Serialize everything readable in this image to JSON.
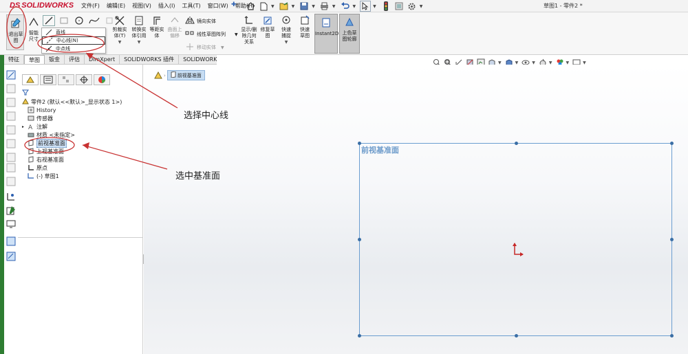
{
  "app": {
    "logo_prefix": "DS",
    "logo_name": "SOLIDWORKS",
    "document_title": "草图1 - 零件2 *"
  },
  "menu": [
    "文件(F)",
    "编辑(E)",
    "视图(V)",
    "插入(I)",
    "工具(T)",
    "窗口(W)",
    "帮助(H)"
  ],
  "ribbon": {
    "exit_sketch": "退出草图",
    "smart_dim": "智能尺寸",
    "line_flyout": [
      "直线",
      "中心线(N)",
      "中点线"
    ],
    "trim": "剪裁实体(T)",
    "convert": "转换实体引用",
    "offset": "等距实体",
    "surface_offset": "曲面上偏移",
    "mirror": "镜向实体",
    "linear_pattern": "线性草图阵列",
    "move": "移动实体",
    "display_relations": "显示/删除几何关系",
    "repair": "修复草图",
    "quick_snap": "快速捕捉",
    "rapid_sketch": "快速草图",
    "instant2d": "Instant2D",
    "shaded_contours": "上色草图轮廓"
  },
  "tabs": [
    "特征",
    "草图",
    "钣金",
    "评估",
    "DimXpert",
    "SOLIDWORKS 插件",
    "SOLIDWORKS MBD"
  ],
  "tree": {
    "root": "零件2 (默认<<默认>_显示状态 1>)",
    "items": [
      "History",
      "传感器",
      "注解",
      "材质 <未指定>",
      "前视基准面",
      "上视基准面",
      "右视基准面",
      "原点",
      "(-) 草图1"
    ]
  },
  "viewport": {
    "breadcrumb_plane": "前视基准面",
    "plane_label": "前视基准面"
  },
  "annotations": {
    "select_centerline": "选择中心线",
    "select_plane": "选中基准面"
  },
  "colors": {
    "brand_red": "#c8102e",
    "annotation_red": "#c83232",
    "plane_blue": "#6a9dd0",
    "selection_blue": "#cfe2f7"
  }
}
